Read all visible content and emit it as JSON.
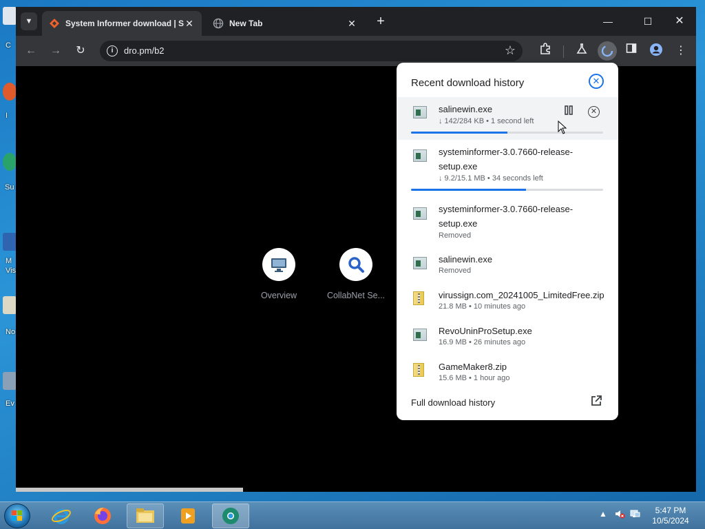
{
  "desktop": {
    "icons": [
      {
        "label": "C",
        "color": "#dfe6ee"
      },
      {
        "label": "I",
        "color": "#e05a2b"
      },
      {
        "label": "Su",
        "color": "#2aa36b"
      },
      {
        "label": "M Visu",
        "color": "#2f64b0"
      },
      {
        "label": "No",
        "color": "#dcd8c6"
      },
      {
        "label": "Ev",
        "color": "#8aa0b6"
      }
    ]
  },
  "browser": {
    "tabs": [
      {
        "title": "System Informer download | S",
        "active": true
      },
      {
        "title": "New Tab",
        "active": false
      }
    ],
    "url": "dro.pm/b2",
    "new_tab_symbol": "+",
    "shortcuts": [
      {
        "label": "Overview"
      },
      {
        "label": "CollabNet Se..."
      }
    ]
  },
  "downloads": {
    "title": "Recent download history",
    "items": [
      {
        "name": "salinewin.exe",
        "status": "↓ 142/284 KB • 1 second left",
        "type": "exe",
        "progress": 0.5,
        "in_progress": true,
        "hover": true
      },
      {
        "name": "systeminformer-3.0.7660-release-setup.exe",
        "status": "↓ 9.2/15.1 MB • 34 seconds left",
        "type": "exe",
        "progress": 0.6,
        "in_progress": true
      },
      {
        "name": "systeminformer-3.0.7660-release-setup.exe",
        "status": "Removed",
        "type": "exe"
      },
      {
        "name": "salinewin.exe",
        "status": "Removed",
        "type": "exe"
      },
      {
        "name": "virussign.com_20241005_LimitedFree.zip",
        "status": "21.8 MB • 10 minutes ago",
        "type": "zip"
      },
      {
        "name": "RevoUninProSetup.exe",
        "status": "16.9 MB • 26 minutes ago",
        "type": "exe"
      },
      {
        "name": "GameMaker8.zip",
        "status": "15.6 MB • 1 hour ago",
        "type": "zip"
      }
    ],
    "footer": "Full download history"
  },
  "taskbar": {
    "time": "5:47 PM",
    "date": "10/5/2024"
  }
}
